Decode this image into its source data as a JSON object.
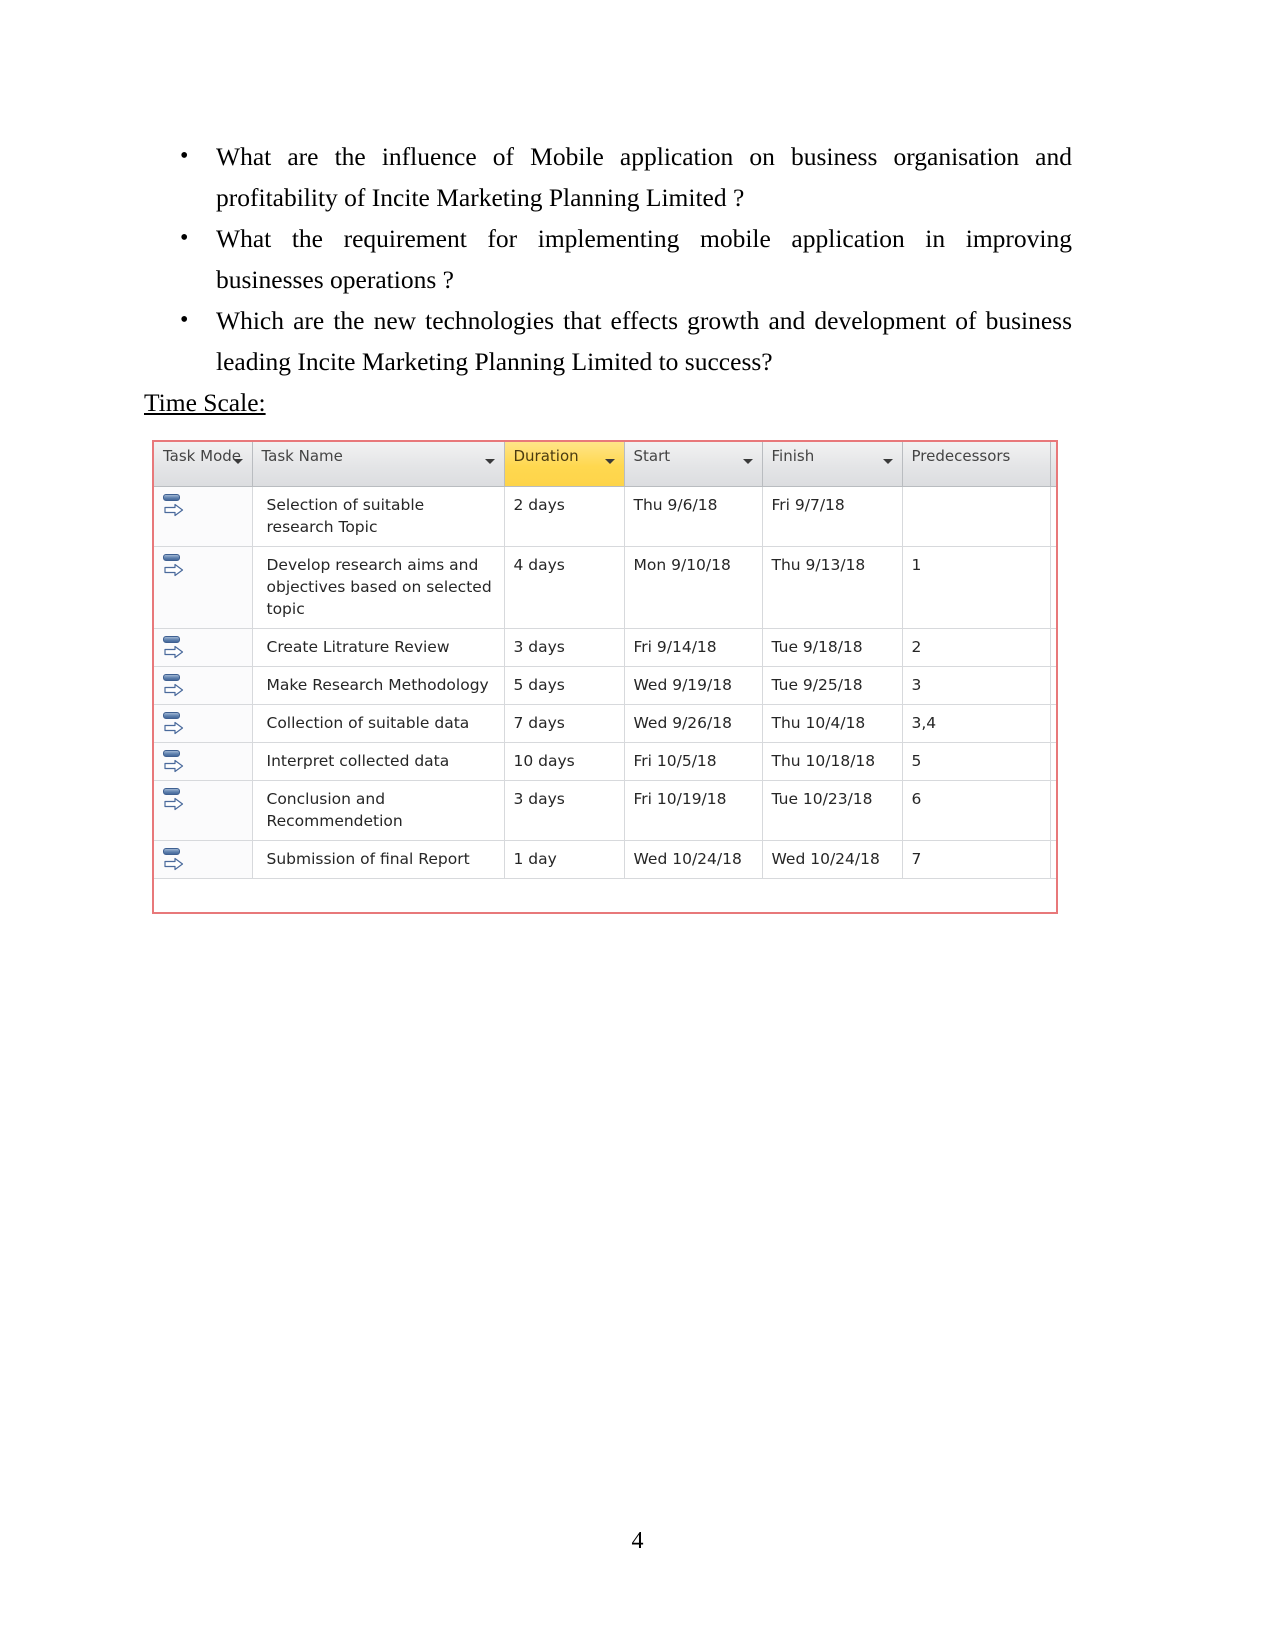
{
  "document": {
    "page_number": "4",
    "section_heading": "Time Scale:",
    "questions": [
      {
        "bullet": "•",
        "text": "What are the influence of Mobile application on business organisation and profitability of Incite Marketing Planning Limited ?"
      },
      {
        "bullet": "•",
        "text": "What the requirement for implementing mobile application in improving businesses operations ?"
      },
      {
        "bullet": "•",
        "text": "Which are the new technologies that effects growth and development of business leading Incite Marketing Planning Limited to success?"
      }
    ]
  },
  "project_table": {
    "border_color": "#e8787a",
    "highlight_color": "#ffd84f",
    "columns": [
      {
        "label": "Task Mode",
        "key": "task_mode",
        "highlighted": false,
        "has_filter_arrow": true
      },
      {
        "label": "Task Name",
        "key": "task_name",
        "highlighted": false,
        "has_filter_arrow": true
      },
      {
        "label": "Duration",
        "key": "duration",
        "highlighted": true,
        "has_filter_arrow": true
      },
      {
        "label": "Start",
        "key": "start",
        "highlighted": false,
        "has_filter_arrow": true
      },
      {
        "label": "Finish",
        "key": "finish",
        "highlighted": false,
        "has_filter_arrow": true
      },
      {
        "label": "Predecessors",
        "key": "predecessors",
        "highlighted": false,
        "has_filter_arrow": true
      }
    ],
    "rows": [
      {
        "task_mode_icon": "manually-scheduled-task-icon",
        "task_name": "Selection of suitable research Topic",
        "duration": "2 days",
        "start": "Thu 9/6/18",
        "finish": "Fri 9/7/18",
        "predecessors": ""
      },
      {
        "task_mode_icon": "manually-scheduled-task-icon",
        "task_name": "Develop research aims and objectives based on selected topic",
        "duration": "4 days",
        "start": "Mon 9/10/18",
        "finish": "Thu 9/13/18",
        "predecessors": "1"
      },
      {
        "task_mode_icon": "manually-scheduled-task-icon",
        "task_name": "Create Litrature Review",
        "duration": "3 days",
        "start": "Fri 9/14/18",
        "finish": "Tue 9/18/18",
        "predecessors": "2"
      },
      {
        "task_mode_icon": "manually-scheduled-task-icon",
        "task_name": "Make Research Methodology",
        "duration": "5 days",
        "start": "Wed 9/19/18",
        "finish": "Tue 9/25/18",
        "predecessors": "3"
      },
      {
        "task_mode_icon": "manually-scheduled-task-icon",
        "task_name": "Collection of suitable data",
        "duration": "7 days",
        "start": "Wed 9/26/18",
        "finish": "Thu 10/4/18",
        "predecessors": "3,4"
      },
      {
        "task_mode_icon": "manually-scheduled-task-icon",
        "task_name": "Interpret collected data",
        "duration": "10 days",
        "start": "Fri 10/5/18",
        "finish": "Thu 10/18/18",
        "predecessors": "5"
      },
      {
        "task_mode_icon": "manually-scheduled-task-icon",
        "task_name": "Conclusion and Recommendetion",
        "duration": "3 days",
        "start": "Fri 10/19/18",
        "finish": "Tue 10/23/18",
        "predecessors": "6"
      },
      {
        "task_mode_icon": "manually-scheduled-task-icon",
        "task_name": "Submission of final Report",
        "duration": "1 day",
        "start": "Wed 10/24/18",
        "finish": "Wed 10/24/18",
        "predecessors": "7"
      }
    ]
  }
}
